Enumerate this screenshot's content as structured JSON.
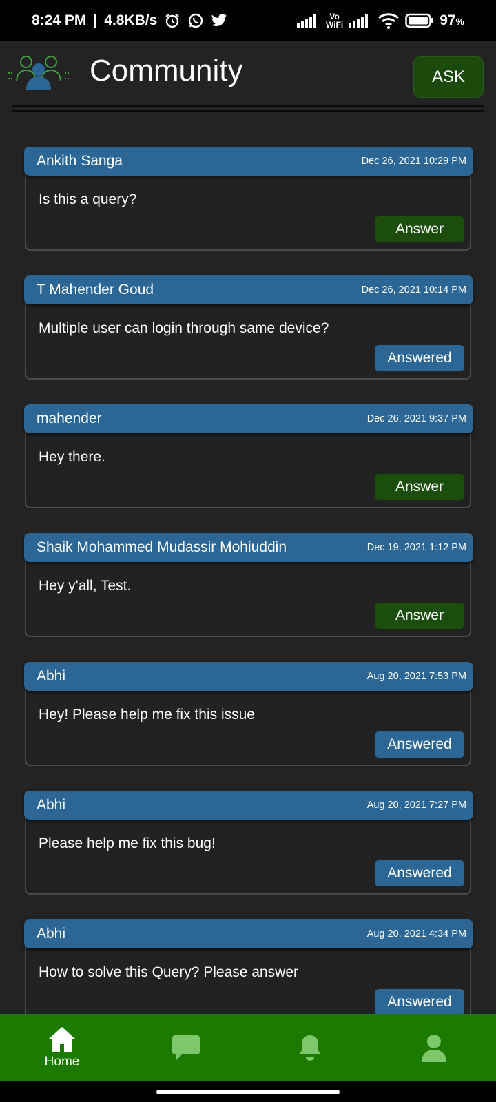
{
  "status_bar": {
    "time": "8:24 PM",
    "separator": "|",
    "net_speed": "4.8KB/s",
    "vowifi_top": "Vo",
    "vowifi_bottom": "WiFi",
    "battery": "97",
    "battery_unit": "%",
    "icons": [
      "alarm-icon",
      "whatsapp-icon",
      "twitter-icon",
      "signal-icon",
      "vowifi-icon",
      "signal-icon",
      "wifi-icon",
      "battery-icon"
    ]
  },
  "header": {
    "title": "Community",
    "ask_label": "ASK",
    "logo_icon": "community-icon"
  },
  "colors": {
    "background": "#232323",
    "card_header": "#2b6694",
    "answer_button": "#1b4d0d",
    "answered_button": "#2b6694",
    "nav_bar": "#1c7a00"
  },
  "posts": [
    {
      "author": "Ankith Sanga",
      "timestamp": "Dec 26, 2021 10:29 PM",
      "question": "Is this a query?",
      "action": "Answer"
    },
    {
      "author": "T Mahender Goud",
      "timestamp": "Dec 26, 2021 10:14 PM",
      "question": "Multiple user can login through same device?",
      "action": "Answered"
    },
    {
      "author": "mahender",
      "timestamp": "Dec 26, 2021 9:37 PM",
      "question": "Hey there.",
      "action": "Answer"
    },
    {
      "author": "Shaik Mohammed Mudassir Mohiuddin",
      "timestamp": "Dec 19, 2021 1:12 PM",
      "question": "Hey y'all, Test.",
      "action": "Answer"
    },
    {
      "author": "Abhi",
      "timestamp": "Aug 20, 2021 7:53 PM",
      "question": "Hey! Please help me fix this issue",
      "action": "Answered"
    },
    {
      "author": "Abhi",
      "timestamp": "Aug 20, 2021 7:27 PM",
      "question": "Please help me fix this bug!",
      "action": "Answered"
    },
    {
      "author": "Abhi",
      "timestamp": "Aug 20, 2021 4:34 PM",
      "question": "How to solve this Query? Please answer",
      "action": "Answered"
    }
  ],
  "bottom_nav": {
    "home_label": "Home",
    "items": [
      "home-icon",
      "chat-icon",
      "bell-icon",
      "profile-icon"
    ]
  }
}
